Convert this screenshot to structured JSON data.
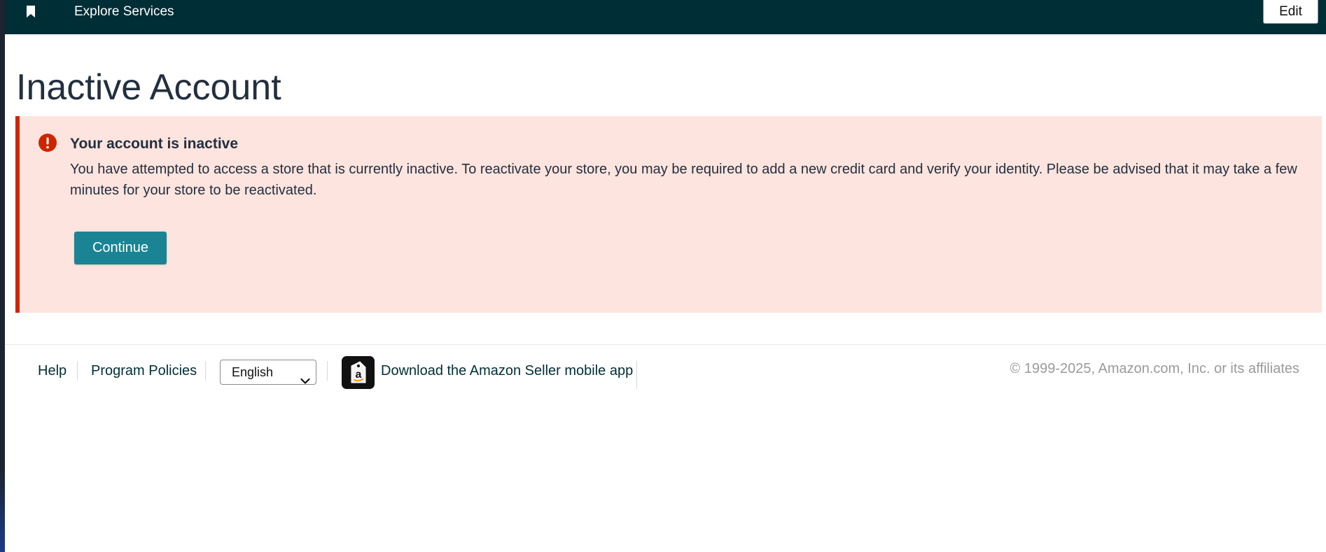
{
  "topbar": {
    "nav_label": "Explore Services",
    "edit_label": "Edit"
  },
  "page": {
    "title": "Inactive Account"
  },
  "alert": {
    "title": "Your account is inactive",
    "body": "You have attempted to access a store that is currently inactive. To reactivate your store, you may be required to add a new credit card and verify your identity. Please be advised that it may take a few minutes for your store to be reactivated.",
    "button_label": "Continue"
  },
  "footer": {
    "help_label": "Help",
    "policies_label": "Program Policies",
    "language_selected": "English",
    "app_label": "Download the Amazon Seller mobile app",
    "copyright": "© 1999-2025, Amazon.com, Inc. or its affiliates"
  },
  "icons": {
    "bookmark": "bookmark-icon",
    "alert": "error-icon",
    "chevron": "chevron-down-icon",
    "app": "amazon-seller-app-icon"
  },
  "colors": {
    "topbar": "#002e36",
    "alert_bg": "#fde4df",
    "alert_border": "#cc2600",
    "button": "#1a8494"
  }
}
